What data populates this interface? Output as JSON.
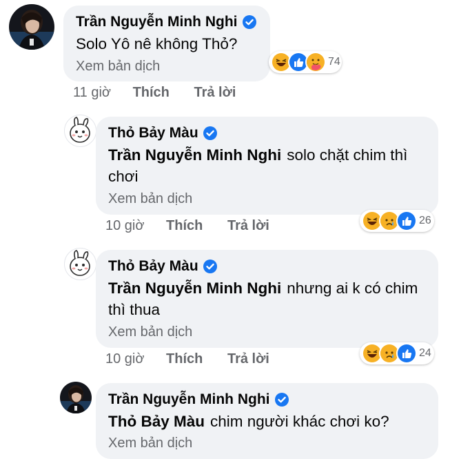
{
  "comments": [
    {
      "author": "Trần Nguyễn Minh Nghi",
      "text": "Solo Yô nê không Thỏ?",
      "mention": "",
      "translate": "Xem bản dịch",
      "time": "11 giờ",
      "like": "Thích",
      "reply": "Trả lời",
      "reactions": [
        "haha",
        "like",
        "care"
      ],
      "reaction_count": "74"
    },
    {
      "author": "Thỏ Bảy Màu",
      "mention": "Trần Nguyễn Minh Nghi",
      "text": "solo chặt chim thì chơi",
      "translate": "Xem bản dịch",
      "time": "10 giờ",
      "like": "Thích",
      "reply": "Trả lời",
      "reactions": [
        "haha",
        "sad",
        "like"
      ],
      "reaction_count": "26"
    },
    {
      "author": "Thỏ Bảy Màu",
      "mention": "Trần Nguyễn Minh Nghi",
      "text": "nhưng ai k có chim thì thua",
      "translate": "Xem bản dịch",
      "time": "10 giờ",
      "like": "Thích",
      "reply": "Trả lời",
      "reactions": [
        "haha",
        "sad",
        "like"
      ],
      "reaction_count": "24"
    },
    {
      "author": "Trần Nguyễn Minh Nghi",
      "mention": "Thỏ Bảy Màu",
      "text": "chim người khác chơi ko?",
      "translate": "Xem bản dịch"
    }
  ],
  "colors": {
    "bubble": "#f0f2f5",
    "verified": "#1877f2",
    "meta_text": "#65676b"
  }
}
